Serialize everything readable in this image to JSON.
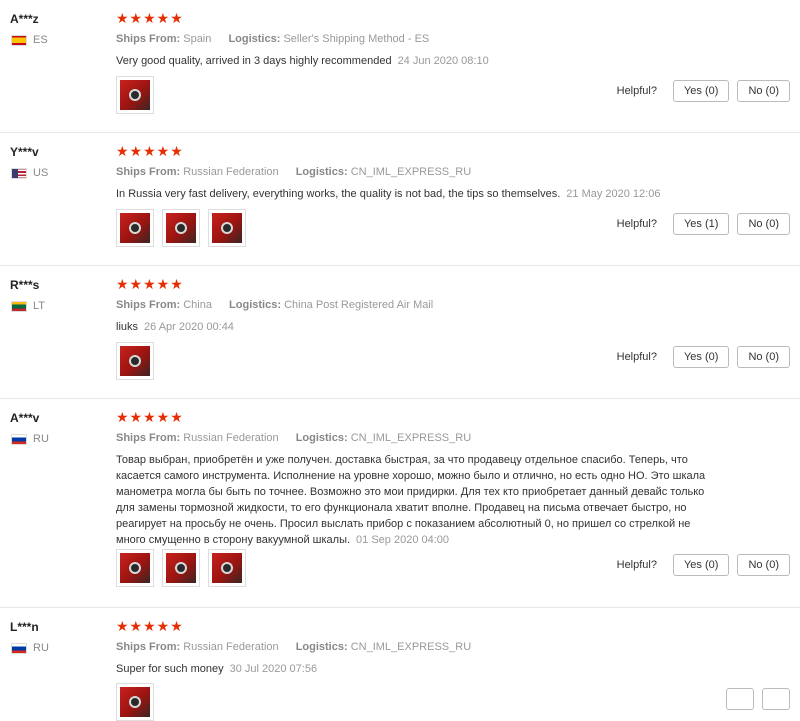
{
  "labels": {
    "ships_from": "Ships From:",
    "logistics": "Logistics:",
    "helpful": "Helpful?"
  },
  "reviews": [
    {
      "user": "A***z",
      "country_code": "ES",
      "flag": "spain-flag-icon",
      "stars": "★★★★★",
      "ships_from": "Spain",
      "logistics": "Seller's Shipping Method - ES",
      "text": "Very good quality, arrived in 3 days highly recommended",
      "date": "24 Jun 2020 08:10",
      "photos": 1,
      "yes": "Yes (0)",
      "no": "No (0)"
    },
    {
      "user": "Y***v",
      "country_code": "US",
      "flag": "us-flag-icon",
      "stars": "★★★★★",
      "ships_from": "Russian Federation",
      "logistics": "CN_IML_EXPRESS_RU",
      "text": "In Russia very fast delivery, everything works, the quality is not bad, the tips so themselves.",
      "date": "21 May 2020 12:06",
      "photos": 3,
      "yes": "Yes (1)",
      "no": "No (0)"
    },
    {
      "user": "R***s",
      "country_code": "LT",
      "flag": "lithuania-flag-icon",
      "stars": "★★★★★",
      "ships_from": "China",
      "logistics": "China Post Registered Air Mail",
      "text": "liuks",
      "date": "26 Apr 2020 00:44",
      "photos": 1,
      "yes": "Yes (0)",
      "no": "No (0)"
    },
    {
      "user": "A***v",
      "country_code": "RU",
      "flag": "russia-flag-icon",
      "stars": "★★★★★",
      "ships_from": "Russian Federation",
      "logistics": "CN_IML_EXPRESS_RU",
      "text": "Товар выбран, приобретён и уже получен. доставка быстрая, за что продавецу отдельное спасибо. Теперь, что касается самого инструмента. Исполнение на уровне хорошо, можно было и отлично, но есть одно НО. Это шкала манометра могла бы быть по точнее. Возможно это мои придирки. Для тех кто приобретает данный девайс только для замены тормозной жидкости, то его функционала хватит вполне. Продавец на письма отвечает быстро, но реагирует на просьбу не очень. Просил выслать прибор с показанием абсолютный 0, но пришел со стрелкой не много смущенно в сторону вакуумной шкалы.",
      "date": "01 Sep 2020 04:00",
      "photos": 3,
      "yes": "Yes (0)",
      "no": "No (0)"
    },
    {
      "user": "L***n",
      "country_code": "RU",
      "flag": "russia-flag-icon",
      "stars": "★★★★★",
      "ships_from": "Russian Federation",
      "logistics": "CN_IML_EXPRESS_RU",
      "text": "Super for such money",
      "date": "30 Jul 2020 07:56",
      "photos": 1,
      "yes": "",
      "no": ""
    }
  ]
}
